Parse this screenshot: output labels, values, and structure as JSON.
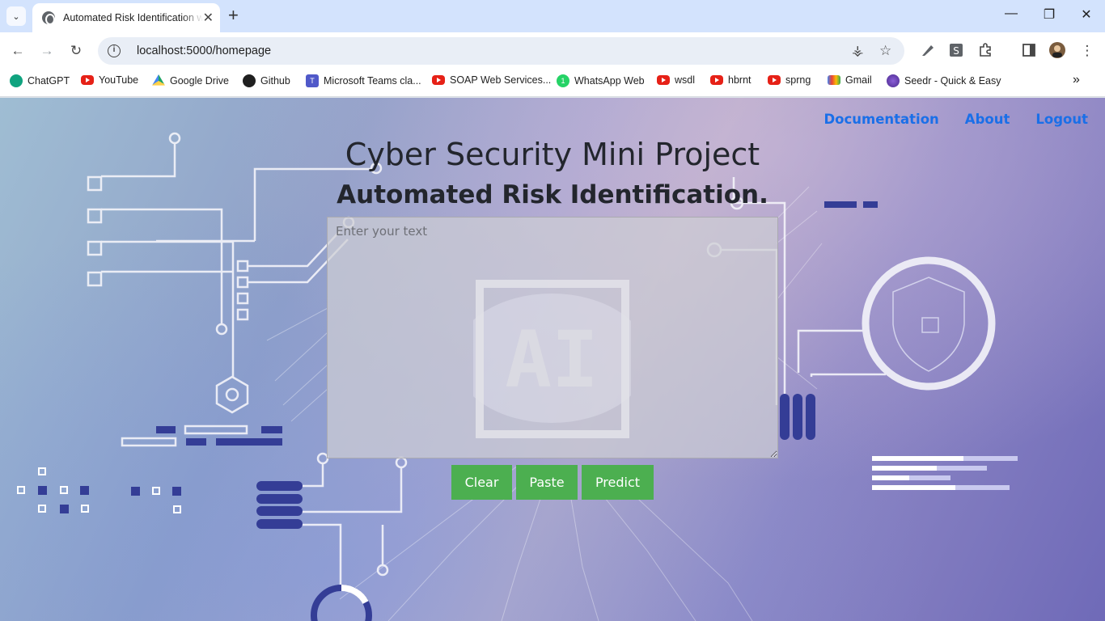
{
  "browser": {
    "tab_title": "Automated Risk Identification w",
    "url": "localhost:5000/homepage"
  },
  "bookmarks": [
    {
      "label": "ChatGPT",
      "icon": "chatgpt-icon"
    },
    {
      "label": "YouTube",
      "icon": "youtube-icon"
    },
    {
      "label": "Google Drive",
      "icon": "google-drive-icon"
    },
    {
      "label": "Github",
      "icon": "github-icon"
    },
    {
      "label": "Microsoft Teams cla...",
      "icon": "teams-icon"
    },
    {
      "label": "SOAP Web Services...",
      "icon": "youtube-icon"
    },
    {
      "label": "WhatsApp Web",
      "icon": "whatsapp-icon"
    },
    {
      "label": "wsdl",
      "icon": "youtube-icon"
    },
    {
      "label": "hbrnt",
      "icon": "youtube-icon"
    },
    {
      "label": "sprng",
      "icon": "youtube-icon"
    },
    {
      "label": "Gmail",
      "icon": "gmail-icon"
    },
    {
      "label": "Seedr - Quick & Easy",
      "icon": "seedr-icon"
    }
  ],
  "nav": {
    "documentation": "Documentation",
    "about": "About",
    "logout": "Logout"
  },
  "page": {
    "title": "Cyber Security Mini Project",
    "subtitle": "Automated Risk Identification.",
    "textarea_placeholder": "Enter your text",
    "ai_art_text": "AI"
  },
  "buttons": {
    "clear": "Clear",
    "paste": "Paste",
    "predict": "Predict"
  },
  "colors": {
    "accent_green": "#4caf50",
    "nav_link": "#1a6fe8"
  }
}
